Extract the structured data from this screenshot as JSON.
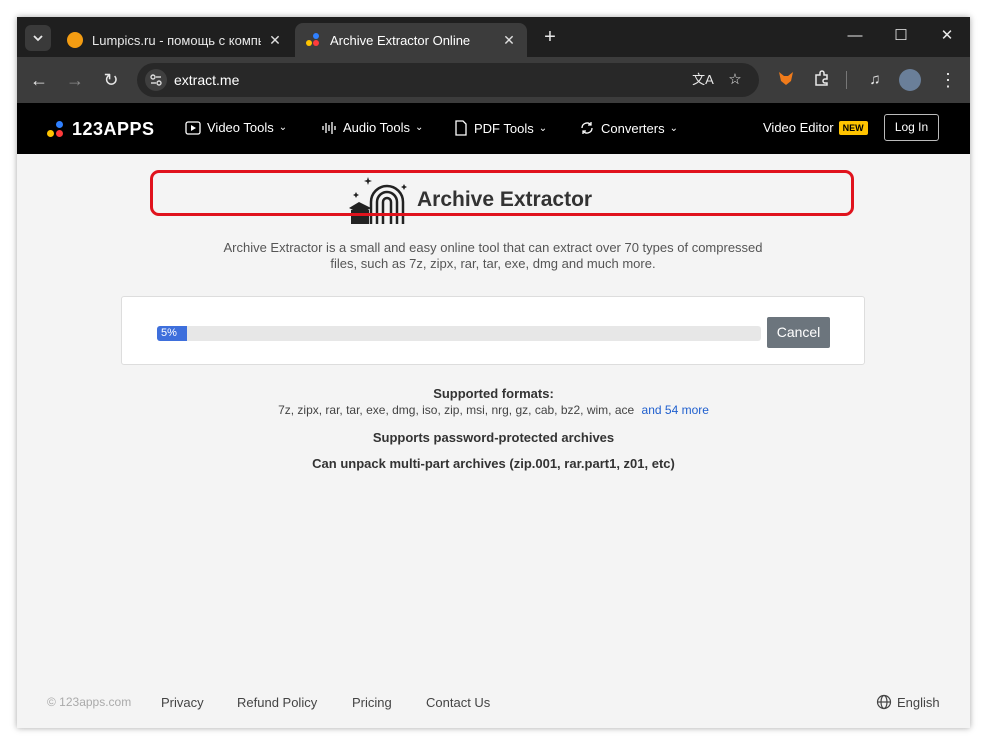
{
  "browser": {
    "tabs": [
      {
        "title": "Lumpics.ru - помощь с компьютером",
        "active": false
      },
      {
        "title": "Archive Extractor Online",
        "active": true
      }
    ],
    "new_tab_label": "+",
    "address": "extract.me"
  },
  "site": {
    "logo_text": "123APPS",
    "menu": [
      {
        "label": "Video Tools",
        "icon": "play-icon"
      },
      {
        "label": "Audio Tools",
        "icon": "waveform-icon"
      },
      {
        "label": "PDF Tools",
        "icon": "document-icon"
      },
      {
        "label": "Converters",
        "icon": "convert-icon"
      }
    ],
    "video_editor_label": "Video Editor",
    "new_badge": "NEW",
    "login_label": "Log In"
  },
  "main": {
    "title": "Archive Extractor",
    "description": "Archive Extractor is a small and easy online tool that can extract over 70 types of compressed files, such as 7z, zipx, rar, tar, exe, dmg and much more.",
    "progress": {
      "percent": 5,
      "label": "5%"
    },
    "cancel_label": "Cancel",
    "formats_title": "Supported formats:",
    "formats_list": "7z, zipx, rar, tar, exe, dmg, iso, zip, msi, nrg, gz, cab, bz2, wim, ace",
    "formats_more": "and 54 more",
    "feature_password": "Supports password-protected archives",
    "feature_multipart": "Can unpack multi-part archives (zip.001, rar.part1, z01, etc)"
  },
  "footer": {
    "copyright": "© 123apps.com",
    "links": [
      "Privacy",
      "Refund Policy",
      "Pricing",
      "Contact Us"
    ],
    "language": "English"
  },
  "colors": {
    "progress": "#3e6fdc",
    "highlight": "#e0131d",
    "header_bg": "#000000",
    "badge": "#ffc400"
  }
}
